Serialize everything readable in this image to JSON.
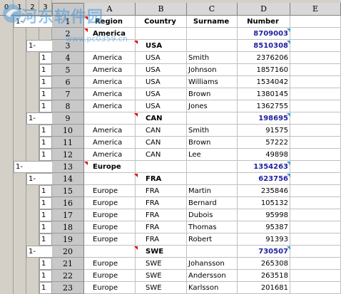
{
  "outline": {
    "levels": [
      "0",
      "1",
      "2",
      "3"
    ],
    "markers": [
      {
        "row": "1",
        "level": "1",
        "text": "1-"
      },
      {
        "row": "3",
        "level": "2",
        "text": "1-"
      },
      {
        "row": "9",
        "level": "2",
        "text": "1-"
      },
      {
        "row": "13",
        "level": "1",
        "text": "1-"
      },
      {
        "row": "14",
        "level": "2",
        "text": "1-"
      },
      {
        "row": "20",
        "level": "2",
        "text": "1-"
      }
    ],
    "detail_mark": "1"
  },
  "sheet": {
    "columns": [
      "A",
      "B",
      "C",
      "D",
      "E"
    ],
    "rows": [
      {
        "n": "1",
        "a": "Region",
        "b": "Country",
        "c": "Surname",
        "d": "Number",
        "kind": "header"
      },
      {
        "n": "2",
        "a": "America",
        "b": "",
        "c": "",
        "d": "8709003",
        "kind": "region"
      },
      {
        "n": "3",
        "a": "",
        "b": "USA",
        "c": "",
        "d": "8510308",
        "kind": "country"
      },
      {
        "n": "4",
        "a": "America",
        "b": "USA",
        "c": "Smith",
        "d": "2376206",
        "kind": "detail"
      },
      {
        "n": "5",
        "a": "America",
        "b": "USA",
        "c": "Johnson",
        "d": "1857160",
        "kind": "detail"
      },
      {
        "n": "6",
        "a": "America",
        "b": "USA",
        "c": "Williams",
        "d": "1534042",
        "kind": "detail"
      },
      {
        "n": "7",
        "a": "America",
        "b": "USA",
        "c": "Brown",
        "d": "1380145",
        "kind": "detail"
      },
      {
        "n": "8",
        "a": "America",
        "b": "USA",
        "c": "Jones",
        "d": "1362755",
        "kind": "detail"
      },
      {
        "n": "9",
        "a": "",
        "b": "CAN",
        "c": "",
        "d": "198695",
        "kind": "country"
      },
      {
        "n": "10",
        "a": "America",
        "b": "CAN",
        "c": "Smith",
        "d": "91575",
        "kind": "detail"
      },
      {
        "n": "11",
        "a": "America",
        "b": "CAN",
        "c": "Brown",
        "d": "57222",
        "kind": "detail"
      },
      {
        "n": "12",
        "a": "America",
        "b": "CAN",
        "c": "Lee",
        "d": "49898",
        "kind": "detail"
      },
      {
        "n": "13",
        "a": "Europe",
        "b": "",
        "c": "",
        "d": "1354263",
        "kind": "region"
      },
      {
        "n": "14",
        "a": "",
        "b": "FRA",
        "c": "",
        "d": "623756",
        "kind": "country"
      },
      {
        "n": "15",
        "a": "Europe",
        "b": "FRA",
        "c": "Martin",
        "d": "235846",
        "kind": "detail"
      },
      {
        "n": "16",
        "a": "Europe",
        "b": "FRA",
        "c": "Bernard",
        "d": "105132",
        "kind": "detail"
      },
      {
        "n": "17",
        "a": "Europe",
        "b": "FRA",
        "c": "Dubois",
        "d": "95998",
        "kind": "detail"
      },
      {
        "n": "18",
        "a": "Europe",
        "b": "FRA",
        "c": "Thomas",
        "d": "95387",
        "kind": "detail"
      },
      {
        "n": "19",
        "a": "Europe",
        "b": "FRA",
        "c": "Robert",
        "d": "91393",
        "kind": "detail"
      },
      {
        "n": "20",
        "a": "",
        "b": "SWE",
        "c": "",
        "d": "730507",
        "kind": "country"
      },
      {
        "n": "21",
        "a": "Europe",
        "b": "SWE",
        "c": "Johansson",
        "d": "265308",
        "kind": "detail"
      },
      {
        "n": "22",
        "a": "Europe",
        "b": "SWE",
        "c": "Andersson",
        "d": "263518",
        "kind": "detail"
      },
      {
        "n": "23",
        "a": "Europe",
        "b": "SWE",
        "c": "Karlsson",
        "d": "201681",
        "kind": "detail"
      }
    ]
  },
  "watermark": {
    "text": "河东软件园",
    "url": "www.pc0359.cn"
  },
  "colors": {
    "subtotal": "#1f1fa0",
    "comment_marker": "#dd0000",
    "grid": "#c0c0c0",
    "header_bg": "#d8d8d8"
  }
}
